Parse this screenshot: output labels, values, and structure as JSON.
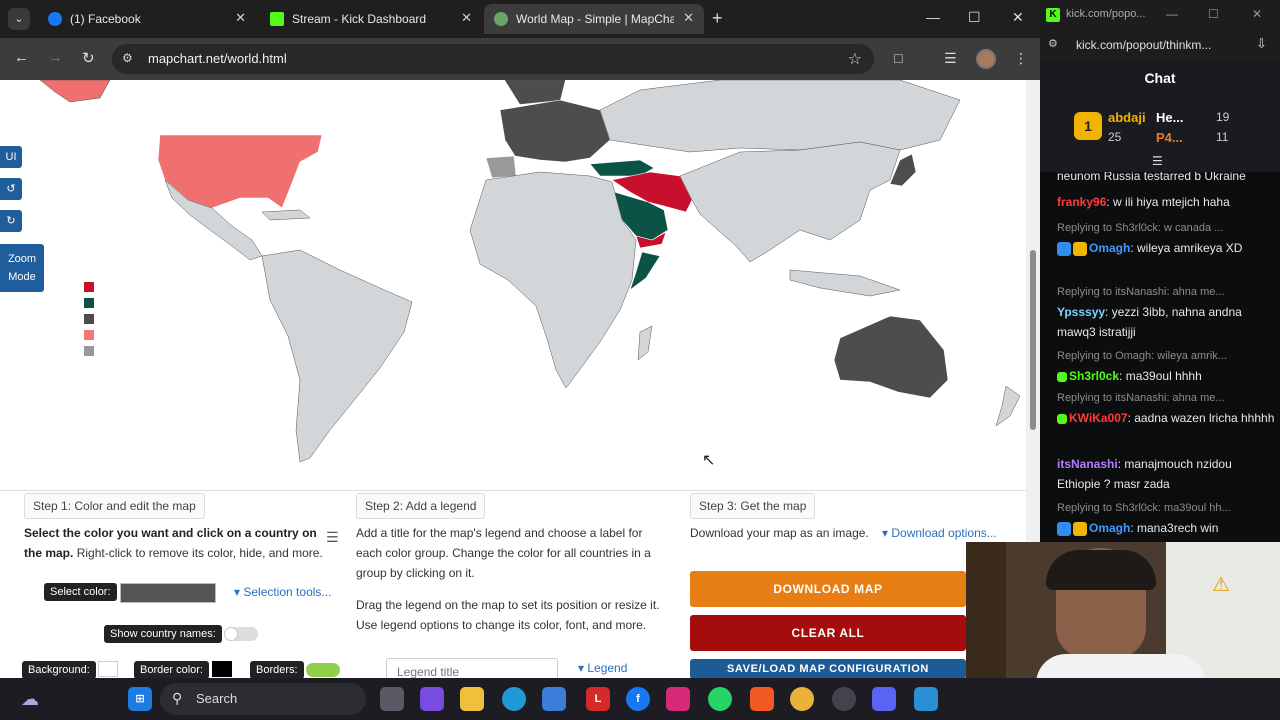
{
  "browser": {
    "tabs": [
      {
        "title": "(1) Facebook",
        "active": false
      },
      {
        "title": "Stream - Kick Dashboard",
        "active": false
      },
      {
        "title": "World Map - Simple | MapChar",
        "active": true
      }
    ],
    "url": "mapchart.net/world.html"
  },
  "map": {
    "side_buttons": {
      "ui": "UI",
      "undo": "↺",
      "redo": "↻",
      "zoom": "Zoom Mode"
    },
    "legend_colors": [
      "#c8102e",
      "#0b5345",
      "#4d4d4d",
      "#f07878",
      "#999999"
    ],
    "colors": {
      "red": "#c8102e",
      "green": "#0b5345",
      "dark": "#4d4d4d",
      "salmon": "#f07070",
      "land": "#d3d6d8"
    }
  },
  "steps": {
    "step1": {
      "header": "Step 1: Color and edit the map",
      "text_a": "Select the color you want and click on a country on the map.",
      "text_b": "Right-click to remove its color, hide, and more.",
      "select_color_label": "Select color:",
      "selection_tools": "Selection tools...",
      "show_country_names": "Show country names:",
      "background_label": "Background:",
      "border_color_label": "Border color:",
      "borders_label": "Borders:"
    },
    "step2": {
      "header": "Step 2: Add a legend",
      "line1": "Add a title for the map's legend and choose a label for each color group.",
      "line2": "Change the color for all countries in a group by clicking on it.",
      "line3": "Drag the legend on the map to set its position or resize it.",
      "line4": "Use legend options to change its color, font, and more.",
      "legend_title_placeholder": "Legend title",
      "legend_link": "Legend"
    },
    "step3": {
      "header": "Step 3: Get the map",
      "line1": "Download your map as an image.",
      "download_options": "Download options...",
      "download_btn": "DOWNLOAD MAP",
      "clear_btn": "CLEAR ALL",
      "save_btn": "SAVE/LOAD MAP CONFIGURATION"
    }
  },
  "chat": {
    "window_url_a": "kick.com/popo...",
    "window_url_b": "kick.com/popout/thinkm...",
    "title": "Chat",
    "leaderboard": [
      {
        "name": "abdaji",
        "rank": "1",
        "value": "25"
      },
      {
        "name": "He...",
        "value": "19"
      },
      {
        "name": "P4...",
        "value": "11"
      }
    ],
    "messages": [
      {
        "user": "",
        "text": "neunom Russia testarred b Ukraine"
      },
      {
        "user": "franky96",
        "text": ": w ili hiya mtejich haha"
      },
      {
        "reply": "Replying to Sh3rl0ck: w canada ...",
        "user": "Omagh",
        "text": ": wileya amrikeya XD"
      },
      {
        "reply": "Replying to itsNanashi: ahna me...",
        "user": "Ypsssyy",
        "text": ": yezzi 3ibb, nahna andna mawq3 istratijji"
      },
      {
        "reply": "Replying to Omagh: wileya amrik...",
        "user": "Sh3rl0ck",
        "text": ": ma39oul hhhh"
      },
      {
        "reply": "Replying to itsNanashi: ahna me...",
        "user": "KWiKa007",
        "text": ": aadna wazen lricha hhhhh"
      },
      {
        "user": "itsNanashi",
        "text": ": manajmouch nzidou Ethiopie ? masr zada"
      },
      {
        "reply": "Replying to Sh3rl0ck: ma39oul hh...",
        "user": "Omagh",
        "text": ": mana3rech win"
      }
    ]
  },
  "taskbar": {
    "search": "Search"
  }
}
